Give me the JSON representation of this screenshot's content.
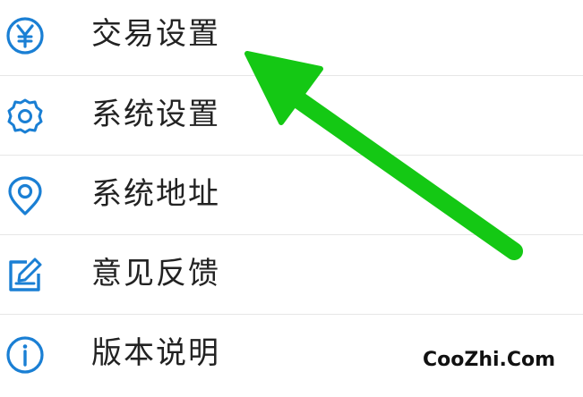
{
  "colors": {
    "icon_blue": "#1a7fd4",
    "arrow_green": "#14c814",
    "label_text": "#222222",
    "divider": "#e6e6e6"
  },
  "menu": {
    "items": [
      {
        "label": "交易设置",
        "icon": "yen-circle-icon"
      },
      {
        "label": "系统设置",
        "icon": "gear-icon"
      },
      {
        "label": "系统地址",
        "icon": "location-pin-icon"
      },
      {
        "label": "意见反馈",
        "icon": "edit-icon"
      },
      {
        "label": "版本说明",
        "icon": "info-icon"
      }
    ]
  },
  "annotation": {
    "arrow": "green-arrow-pointing-up-left"
  },
  "watermark": {
    "text": "CooZhi.Com"
  }
}
